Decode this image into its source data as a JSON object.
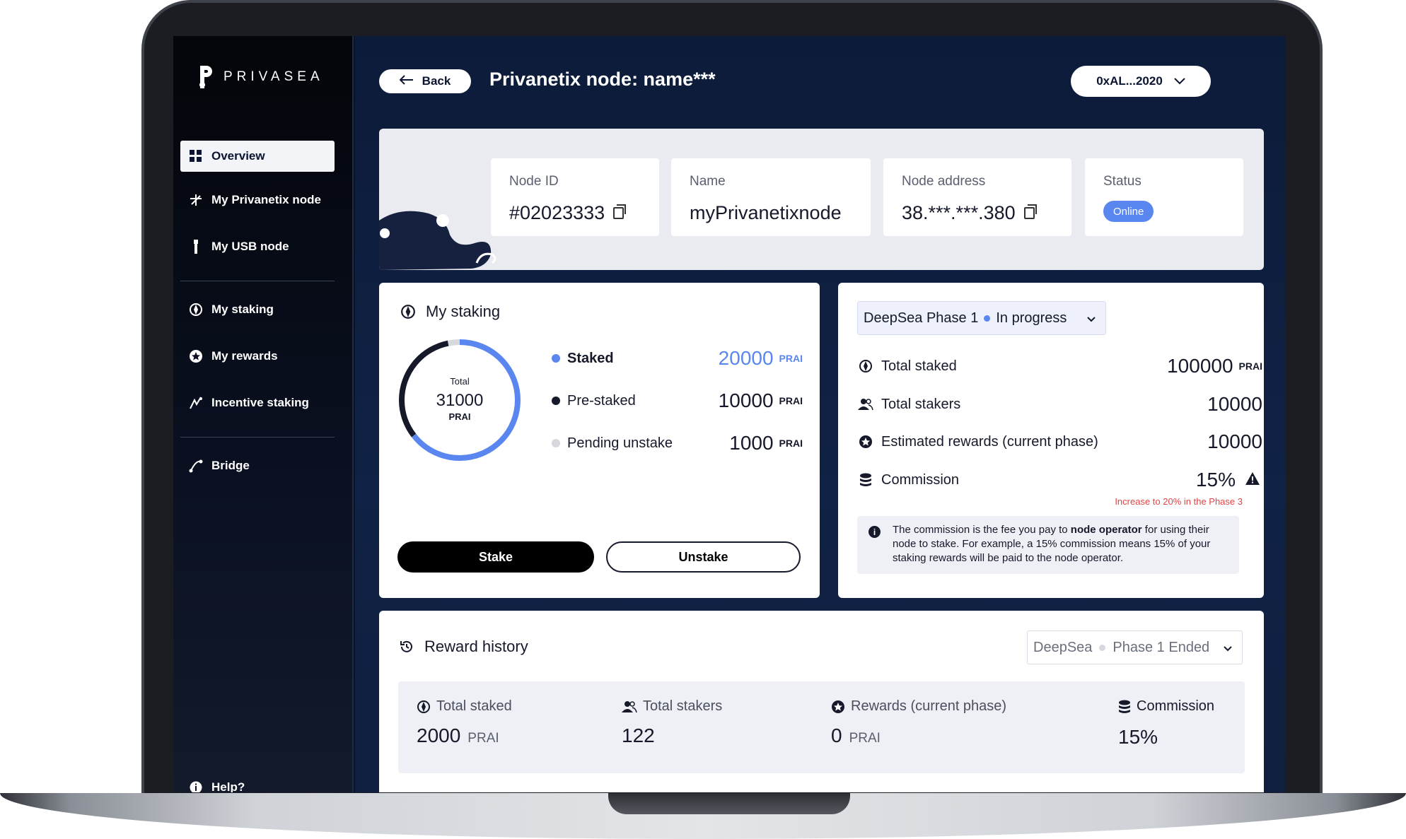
{
  "brand": {
    "name": "PRIVASEA"
  },
  "sidebar": {
    "items": [
      {
        "label": "Overview"
      },
      {
        "label": "My Privanetix node"
      },
      {
        "label": "My USB node"
      },
      {
        "label": "My staking"
      },
      {
        "label": "My rewards"
      },
      {
        "label": "Incentive staking"
      },
      {
        "label": "Bridge"
      }
    ],
    "help_label": "Help?"
  },
  "header": {
    "back_label": "Back",
    "title": "Privanetix node: name***",
    "wallet": "0xAL...2020"
  },
  "node_info": {
    "node_id_label": "Node ID",
    "node_id": "#02023333",
    "name_label": "Name",
    "name": "myPrivanetixnode",
    "address_label": "Node address",
    "address": "38.***.***.380",
    "status_label": "Status",
    "status": "Online"
  },
  "my_staking": {
    "title": "My staking",
    "donut_label": "Total",
    "total": "31000",
    "unit": "PRAI",
    "items": [
      {
        "label": "Staked",
        "value": "20000",
        "unit": "PRAI",
        "color": "#5a86f0",
        "amount": 20000
      },
      {
        "label": "Pre-staked",
        "value": "10000",
        "unit": "PRAI",
        "color": "#15192a",
        "amount": 10000
      },
      {
        "label": "Pending unstake",
        "value": "1000",
        "unit": "PRAI",
        "color": "#d6d8de",
        "amount": 1000
      }
    ],
    "stake_label": "Stake",
    "unstake_label": "Unstake"
  },
  "phase": {
    "name": "DeepSea Phase 1",
    "state": "In progress",
    "stats": [
      {
        "label": "Total staked",
        "value": "100000",
        "unit": "PRAI"
      },
      {
        "label": "Total stakers",
        "value": "10000"
      },
      {
        "label": "Estimated rewards (current phase)",
        "value": "10000"
      },
      {
        "label": "Commission",
        "value": "15%"
      }
    ],
    "warning": "Increase to 20% in the Phase 3",
    "info_pre": "The commission is the fee you pay to ",
    "info_bold": "node operator",
    "info_post": " for using their node to stake. For example, a 15% commission means 15% of your staking rewards will be paid to the node operator."
  },
  "reward_history": {
    "title": "Reward history",
    "select_left": "DeepSea",
    "select_right": "Phase 1 Ended",
    "cols": [
      {
        "label": "Total staked",
        "value": "2000",
        "unit": "PRAI"
      },
      {
        "label": "Total stakers",
        "value": "122"
      },
      {
        "label": "Rewards (current phase)",
        "value": "0",
        "unit": "PRAI"
      },
      {
        "label": "Commission",
        "value": "15%"
      }
    ]
  }
}
